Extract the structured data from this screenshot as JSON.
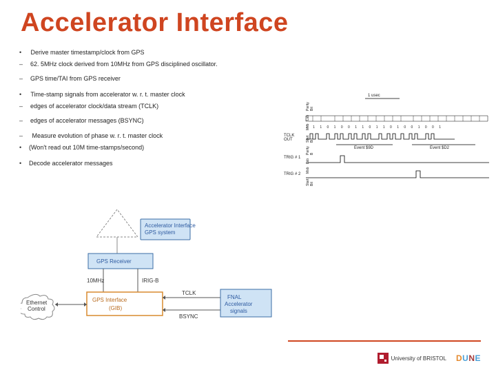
{
  "title": "Accelerator Interface",
  "bullets": {
    "b1": "Derive master timestamp/clock from GPS",
    "b1_1": "62. 5MHz clock derived from 10MHz from GPS disciplined oscillator.",
    "b1_2": "GPS time/TAI from GPS receiver",
    "b2": "Time-stamp signals from accelerator w. r. t. master clock",
    "b2_1": "edges of accelerator clock/data stream (TCLK)",
    "b2_2": "edges of accelerator messages (BSYNC)",
    "b2_3": "Measure evolution of phase w. r. t. master clock",
    "b2_3_1": "(Won't read out 10M time-stamps/second)",
    "b3": "Decode accelerator messages"
  },
  "timing": {
    "top_span": "1 usec",
    "vlabels": {
      "l0": "Start Bit",
      "l1": "Msb",
      "l2": "Lsb",
      "l3": "Parity B",
      "l4": "Start Bit",
      "l5": "Msb",
      "l6": "Lsb",
      "l7": "Parity Bit"
    },
    "bits_text": "1 1   1 0 1 0 0 1 1 0 1   1 0 1 0 0 1 0 0 1",
    "row_tclk": "TCLK OUT",
    "row_trig1": "TRIG # 1",
    "row_trig2": "TRIG # 2",
    "evt1": "Event $9D",
    "evt2": "Event $D2"
  },
  "block": {
    "top_box1": "Accelerator Interface",
    "top_box2": "GPS system",
    "gps_rx": "GPS Receiver",
    "tenmhz": "10MHz",
    "irigb": "IRIG-B",
    "gib": "GPS Interface (GIB)",
    "tclk": "TCLK",
    "bsync": "BSYNC",
    "fnal": "FNAL Accelerator signals",
    "eth": "Ethernet Control"
  },
  "footer": {
    "bristol": "University of BRISTOL",
    "dune": {
      "d": "D",
      "u": "U",
      "n": "N",
      "e": "E"
    }
  }
}
